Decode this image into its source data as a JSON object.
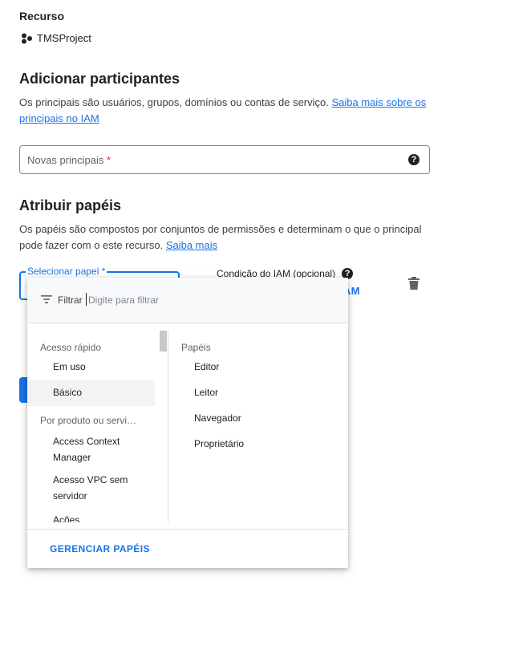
{
  "resource": {
    "section_label": "Recurso",
    "project_name": "TMSProject"
  },
  "add_principals": {
    "heading": "Adicionar participantes",
    "description": "Os principais são usuários, grupos, domínios ou contas de serviço. ",
    "learn_more_link": "Saiba mais sobre os principais no IAM",
    "field_placeholder": "Novas principais",
    "field_required_mark": "*",
    "field_value": ""
  },
  "assign_roles": {
    "heading": "Atribuir papéis",
    "description": "Os papéis são compostos por conjuntos de permissões e determinam o que o principal pode fazer com o este recurso. ",
    "learn_more_link": "Saiba mais",
    "role_select_label": "Selecionar papel",
    "role_select_required_mark": "*",
    "iam_condition_label": "Condição do IAM (opcional)",
    "add_condition_partial": "DO IAM"
  },
  "role_dropdown": {
    "filter_label": "Filtrar",
    "filter_placeholder": "Digite para filtrar",
    "left_categories": [
      {
        "heading": "Acesso rápido",
        "items": [
          "Em uso",
          "Básico"
        ]
      },
      {
        "heading": "Por produto ou servi…",
        "items": [
          "Access Context Manager",
          "Acesso VPC sem servidor",
          "Ações"
        ]
      }
    ],
    "access_context_line1": "Access Context",
    "access_context_line2": "Manager",
    "vpc_line1": "Acesso VPC sem",
    "vpc_line2": "servidor",
    "selected_category": "Básico",
    "right_heading": "Papéis",
    "roles": [
      "Editor",
      "Leitor",
      "Navegador",
      "Proprietário"
    ],
    "manage_roles_button": "GERENCIAR PAPÉIS"
  },
  "icons": {
    "resource": "project-nodes-icon",
    "help": "help-circle-icon",
    "filter": "filter-list-icon",
    "delete": "trash-icon"
  },
  "colors": {
    "accent": "#1a73e8",
    "required": "#d93025"
  }
}
